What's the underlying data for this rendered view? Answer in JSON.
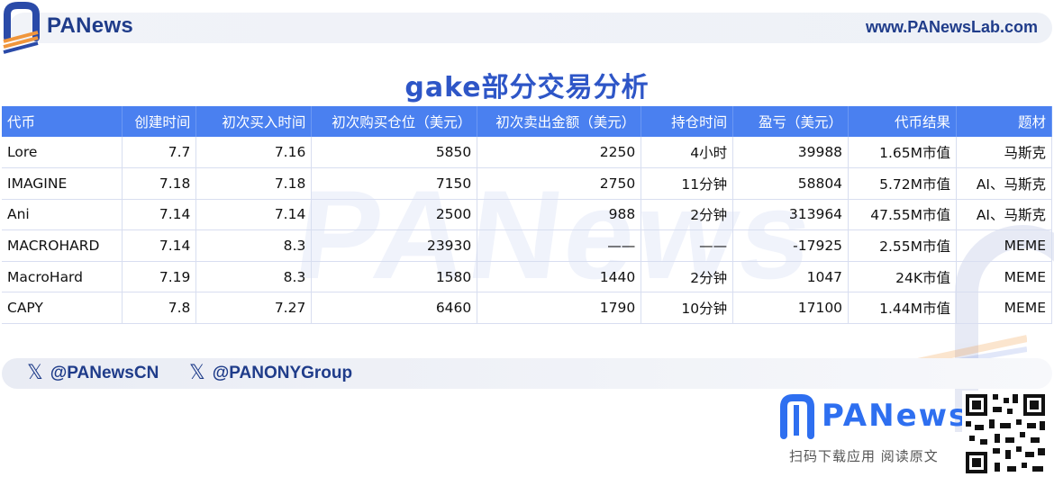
{
  "header": {
    "brand": "PANews",
    "url": "www.PANewsLab.com"
  },
  "watermark": "PANews",
  "table": {
    "title": "gake部分交易分析",
    "columns": [
      "代币",
      "创建时间",
      "初次买入时间",
      "初次购买仓位（美元）",
      "初次卖出金额（美元）",
      "持仓时间",
      "盈亏（美元）",
      "代币结果",
      "题材"
    ],
    "rows": [
      [
        "Lore",
        "7.7",
        "7.16",
        "5850",
        "2250",
        "4小时",
        "39988",
        "1.65M市值",
        "马斯克"
      ],
      [
        "IMAGINE",
        "7.18",
        "7.18",
        "7150",
        "2750",
        "11分钟",
        "58804",
        "5.72M市值",
        "AI、马斯克"
      ],
      [
        "Ani",
        "7.14",
        "7.14",
        "2500",
        "988",
        "2分钟",
        "313964",
        "47.55M市值",
        "AI、马斯克"
      ],
      [
        "MACROHARD",
        "7.14",
        "8.3",
        "23930",
        "——",
        "——",
        "-17925",
        "2.55M市值",
        "MEME"
      ],
      [
        "MacroHard",
        "7.19",
        "8.3",
        "1580",
        "1440",
        "2分钟",
        "1047",
        "24K市值",
        "MEME"
      ],
      [
        "CAPY",
        "7.8",
        "7.27",
        "6460",
        "1790",
        "10分钟",
        "17100",
        "1.44M市值",
        "MEME"
      ]
    ]
  },
  "footer": {
    "social": [
      {
        "icon": "x-icon",
        "handle": "@PANewsCN"
      },
      {
        "icon": "x-icon",
        "handle": "@PANONYGroup"
      }
    ],
    "promo": {
      "name": "PANews",
      "subtitle": "扫码下载应用 阅读原文"
    }
  },
  "colors": {
    "brand": "#1f3c8a",
    "header_row": "#4a80f0",
    "title": "#2e56c7"
  }
}
